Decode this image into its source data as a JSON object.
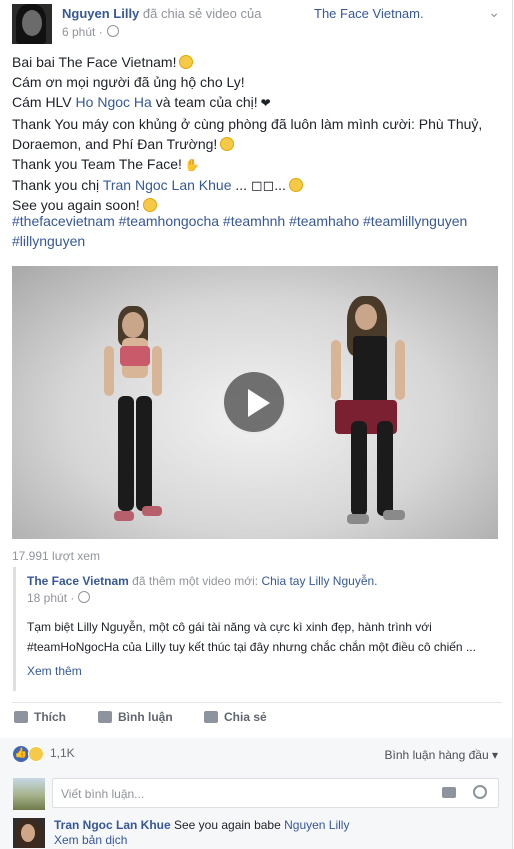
{
  "header": {
    "author": "Nguyen Lilly",
    "action": "đã chia sẻ video của",
    "target": "The Face Vietnam.",
    "time": "6 phút ·",
    "menu_icon": "chevron-down-icon"
  },
  "post": {
    "line1": "Bai bai The Face Vietnam!",
    "line2": "Cám ơn mọi người đã ủng hộ cho Ly!",
    "line3_pre": "Cám HLV",
    "line3_link": "Ho Ngoc Ha",
    "line3_post": "và team của chị!",
    "line4": "Thank You máy con khủng ở cùng phòng đã luôn làm mình cười: Phù Thuỷ,",
    "line5": "Doraemon, and Phí Đan Trường!",
    "line6": "Thank you Team The Face!",
    "line7_pre": "Thank you chị",
    "line7_link": "Tran Ngoc Lan Khue",
    "line7_post": "... ◻◻...",
    "line8": "See you again soon!",
    "tags_line1": "#thefacevietnam #teamhongocha #teamhnh #teamhaho #teamlillynguyen",
    "tags_line2": "#lillynguyen"
  },
  "video": {
    "views": "17.991 lượt xem",
    "play_icon": "play-icon"
  },
  "shared": {
    "page": "The Face Vietnam",
    "action": "đã thêm một video mới:",
    "title": "Chia tay Lilly Nguyễn.",
    "time": "18 phút ·",
    "body_line1": "Tạm biệt Lilly Nguyễn, một cô gái tài năng và cực kì xinh đẹp, hành trình với",
    "body_line2": "#teamHoNgocHa của Lilly tuy kết thúc tại đây nhưng chắc chắn một điều cô chiến ...",
    "see_more": "Xem thêm"
  },
  "actions": {
    "like": "Thích",
    "comment": "Bình luận",
    "share": "Chia sẻ"
  },
  "reactions": {
    "count": "1,1K",
    "sort": "Bình luận hàng đầu ▾"
  },
  "comment_box": {
    "placeholder": "Viết bình luận..."
  },
  "comment": {
    "author": "Tran Ngoc Lan Khue",
    "text": "See you again babe",
    "tag": "Nguyen Lilly",
    "translate": "Xem bản dịch"
  },
  "colors": {
    "link": "#365899",
    "meta": "#90949c",
    "like_blue": "#4267b2"
  }
}
